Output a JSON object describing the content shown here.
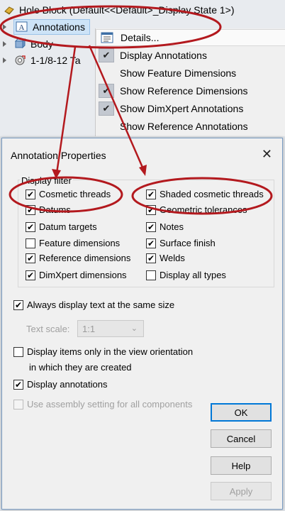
{
  "tree": {
    "title": "Hole Block  (Default<<Default>_Display State 1>)",
    "items": [
      {
        "label": "Annotations",
        "icon": "annotations-icon",
        "selected": true
      },
      {
        "label": "Body",
        "icon": "body-icon"
      },
      {
        "label": "1-1/8-12 Ta",
        "icon": "tap-hole-icon"
      }
    ]
  },
  "context_menu": {
    "items": [
      {
        "label": "Details...",
        "checked": false,
        "icon": "details-icon"
      },
      {
        "label": "Display Annotations",
        "checked": true
      },
      {
        "label": "Show Feature Dimensions",
        "checked": false
      },
      {
        "label": "Show Reference Dimensions",
        "checked": true
      },
      {
        "label": "Show DimXpert Annotations",
        "checked": true
      },
      {
        "label": "Show Reference Annotations",
        "checked": false
      }
    ]
  },
  "dialog": {
    "title": "Annotation Properties",
    "close_glyph": "✕",
    "display_filter": {
      "title": "Display filter",
      "left": [
        {
          "label": "Cosmetic threads",
          "checked": true
        },
        {
          "label": "Datums",
          "checked": true
        },
        {
          "label": "Datum targets",
          "checked": true
        },
        {
          "label": "Feature dimensions",
          "checked": false
        },
        {
          "label": "Reference dimensions",
          "checked": true
        },
        {
          "label": "DimXpert dimensions",
          "checked": true
        }
      ],
      "right": [
        {
          "label": "Shaded cosmetic threads",
          "checked": true
        },
        {
          "label": "Geometric tolerances",
          "checked": true
        },
        {
          "label": "Notes",
          "checked": true
        },
        {
          "label": "Surface finish",
          "checked": true
        },
        {
          "label": "Welds",
          "checked": true
        },
        {
          "label": "Display all types",
          "checked": false
        }
      ]
    },
    "always_same_size": {
      "label": "Always display text at the same size",
      "checked": true
    },
    "text_scale": {
      "label": "Text scale:",
      "value": "1:1"
    },
    "view_orientation": {
      "label_line1": "Display items only in the view orientation",
      "label_line2": "in which they are created",
      "checked": false
    },
    "display_annotations": {
      "label": "Display annotations",
      "checked": true
    },
    "assembly_setting": {
      "label": "Use assembly setting for all components",
      "checked": false
    },
    "buttons": {
      "ok": "OK",
      "cancel": "Cancel",
      "help": "Help",
      "apply": "Apply"
    }
  },
  "colors": {
    "annotation_red": "#b3191e",
    "selection_blue": "#cde3f7",
    "ok_border": "#0078d7"
  }
}
